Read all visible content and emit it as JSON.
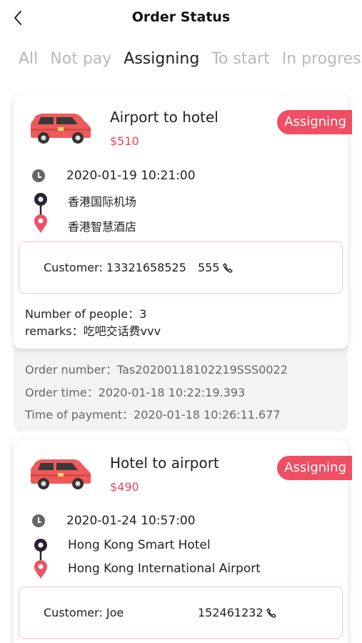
{
  "header": {
    "title": "Order Status"
  },
  "tabs": [
    {
      "label": "All"
    },
    {
      "label": "Not pay"
    },
    {
      "label": "Assigning"
    },
    {
      "label": "To start"
    },
    {
      "label": "In progress"
    }
  ],
  "orders": [
    {
      "route": "Airport to hotel",
      "price": "$510",
      "status": "Assigning",
      "datetime": "2020-01-19 10:21:00",
      "from": "香港国际机场",
      "to": "香港智慧酒店",
      "customer_label": "Customer:",
      "customer_name": "13321658525",
      "customer_phone": "555",
      "people": "Number of people：3",
      "remarks": "remarks：吃吧交话费vvv",
      "order_number": "Order number：Tas20200118102219SSS0022",
      "order_time": "Order time：2020-01-18 10:22:19.393",
      "payment_time": "Time of payment：2020-01-18 10:26:11.677"
    },
    {
      "route": "Hotel to airport",
      "price": "$490",
      "status": "Assigning",
      "datetime": "2020-01-24 10:57:00",
      "from": "Hong Kong Smart Hotel",
      "to": "Hong Kong International Airport",
      "customer_label": "Customer:",
      "customer_name": "Joe",
      "customer_phone": "152461232"
    }
  ],
  "colors": {
    "accent": "#f04e63",
    "price": "#e8455f",
    "border": "#f2c3cb",
    "van": "#ef5a5a"
  }
}
